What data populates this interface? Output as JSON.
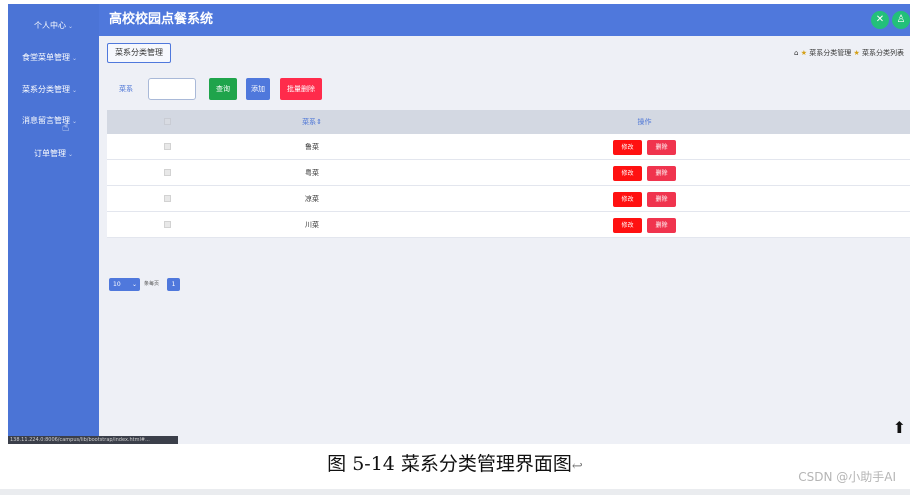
{
  "sidebar": {
    "items": [
      {
        "label": "个人中心"
      },
      {
        "label": "食堂菜单管理"
      },
      {
        "label": "菜系分类管理"
      },
      {
        "label": "消息留言管理"
      },
      {
        "label": "订单管理"
      }
    ],
    "caret": "⌄",
    "cursor": "☝"
  },
  "status_bar": {
    "text": "138.11.224.0:8006/campus/lib/bootstrap/index.html#..."
  },
  "header": {
    "title": "高校校园点餐系统",
    "icons": {
      "left": "✕",
      "right": "♙"
    }
  },
  "main": {
    "tab_label": "菜系分类管理",
    "breadcrumb": {
      "home_icon": "⌂",
      "sep_icon": "★",
      "items": [
        "菜系分类管理",
        "菜系分类列表"
      ]
    },
    "search": {
      "label": "菜系",
      "placeholder": "",
      "query_button": "查询",
      "add_button": "添加",
      "batch_delete_button": "批量删除"
    },
    "table": {
      "columns": [
        "菜系",
        "操作"
      ],
      "sort_marker": "⇕",
      "rows": [
        {
          "name": "鲁菜"
        },
        {
          "name": "粤菜"
        },
        {
          "name": "凉菜"
        },
        {
          "name": "川菜"
        }
      ],
      "edit_label": "修改",
      "delete_label": "删除"
    },
    "pager": {
      "page_size": "10",
      "per_page_label": "条每页",
      "current_page": "1"
    }
  },
  "back_to_top_icon": "⬆",
  "caption": {
    "text": "图 5-14 菜系分类管理界面图",
    "return_mark": "↩"
  },
  "watermark": "CSDN @小助手AI",
  "colors": {
    "sidebar": "#4b74d6",
    "header": "#4f78dc",
    "query_button": "#1fa44b",
    "add_button": "#4f78dc",
    "batch_delete_button": "#ff2b4b",
    "edit_button": "#ff1111",
    "delete_button": "#f0344e"
  }
}
